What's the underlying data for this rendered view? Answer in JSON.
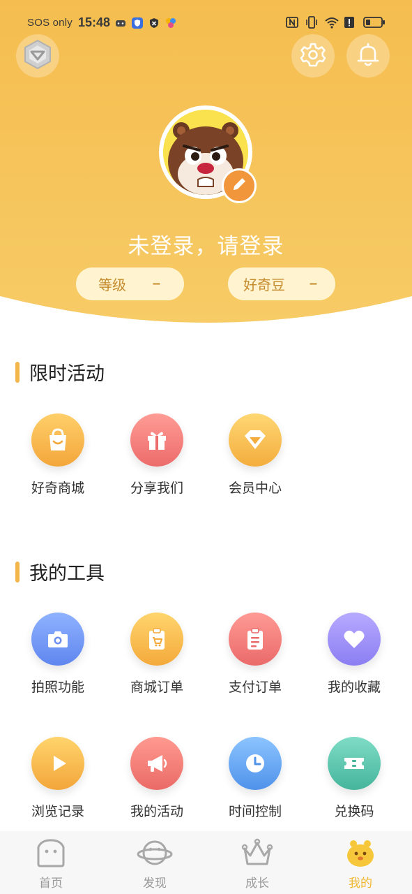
{
  "status_bar": {
    "left_text": "SOS only",
    "time": "15:48"
  },
  "profile": {
    "login_prompt": "未登录，请登录",
    "level_label": "等级",
    "level_value": "–",
    "beans_label": "好奇豆",
    "beans_value": "–"
  },
  "sections": {
    "activities": {
      "title": "限时活动",
      "items": [
        {
          "label": "好奇商城",
          "icon": "shopping-bag-icon",
          "color_from": "#ffcf6a",
          "color_to": "#f3a63a"
        },
        {
          "label": "分享我们",
          "icon": "gift-icon",
          "color_from": "#ff9c95",
          "color_to": "#ec6b6b"
        },
        {
          "label": "会员中心",
          "icon": "diamond-icon",
          "color_from": "#ffd774",
          "color_to": "#f3ad3d"
        }
      ]
    },
    "tools": {
      "title": "我的工具",
      "items": [
        {
          "label": "拍照功能",
          "icon": "camera-icon"
        },
        {
          "label": "商城订单",
          "icon": "cart-clipboard-icon"
        },
        {
          "label": "支付订单",
          "icon": "payment-clipboard-icon"
        },
        {
          "label": "我的收藏",
          "icon": "heart-icon"
        },
        {
          "label": "浏览记录",
          "icon": "play-icon"
        },
        {
          "label": "我的活动",
          "icon": "megaphone-icon"
        },
        {
          "label": "时间控制",
          "icon": "clock-icon"
        },
        {
          "label": "兑换码",
          "icon": "ticket-icon"
        }
      ]
    }
  },
  "bottom_nav": [
    {
      "label": "首页",
      "icon": "home-face-icon"
    },
    {
      "label": "发现",
      "icon": "planet-icon"
    },
    {
      "label": "成长",
      "icon": "crown-icon"
    },
    {
      "label": "我的",
      "icon": "mascot-icon",
      "active": true
    }
  ],
  "colors": {
    "header_yellow": "#f6c256",
    "accent_orange": "#f2963b",
    "active_nav": "#f0b72e"
  }
}
